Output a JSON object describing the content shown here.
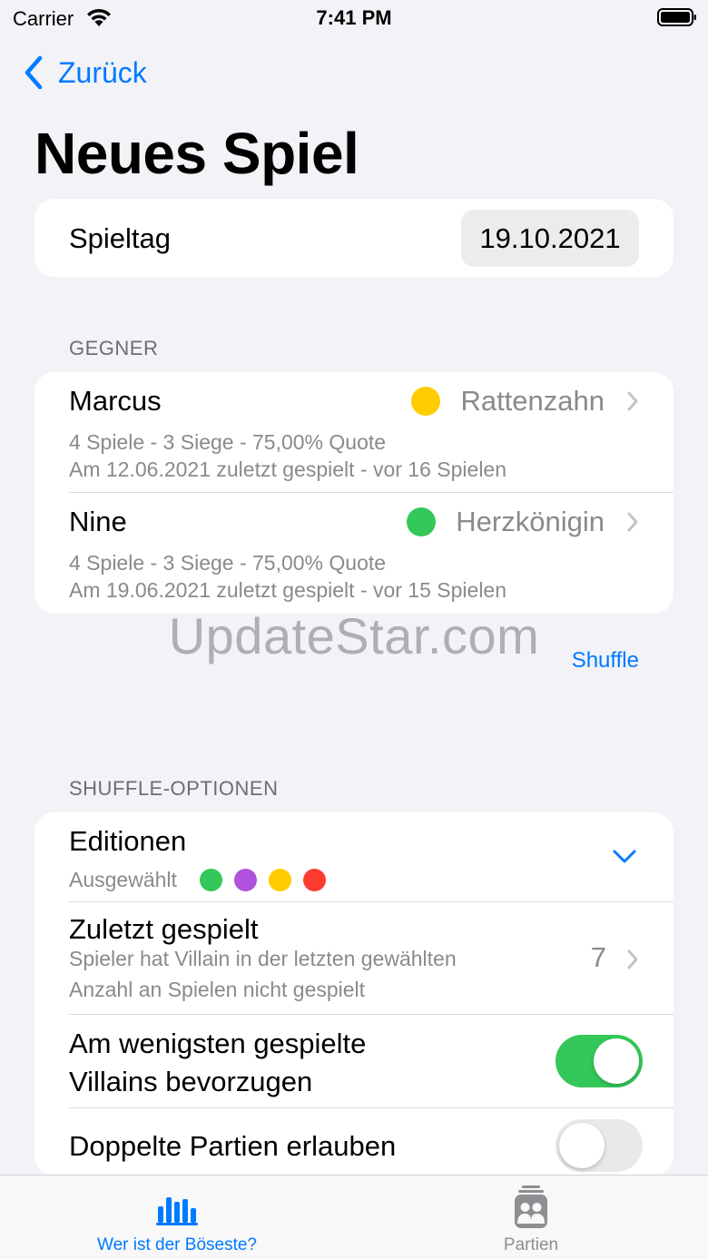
{
  "status_bar": {
    "carrier": "Carrier",
    "time": "7:41 PM"
  },
  "nav": {
    "back_label": "Zurück",
    "title": "Neues Spiel"
  },
  "spieltag": {
    "label": "Spieltag",
    "date": "19.10.2021"
  },
  "gegner": {
    "header": "GEGNER",
    "opponents": [
      {
        "name": "Marcus",
        "villain": "Rattenzahn",
        "dot_color": "#ffcc00",
        "stats": "4 Spiele - 3 Siege - 75,00% Quote",
        "last_played": "Am 12.06.2021 zuletzt gespielt - vor 16 Spielen"
      },
      {
        "name": "Nine",
        "villain": "Herzkönigin",
        "dot_color": "#34c759",
        "stats": "4 Spiele - 3 Siege - 75,00% Quote",
        "last_played": "Am 19.06.2021 zuletzt gespielt - vor 15 Spielen"
      }
    ]
  },
  "watermark": "UpdateStar.com",
  "shuffle_label": "Shuffle",
  "shuffle_options": {
    "header": "SHUFFLE-OPTIONEN",
    "editionen": {
      "title": "Editionen",
      "subtitle": "Ausgewählt",
      "dots": [
        "#34c759",
        "#af52de",
        "#ffcc00",
        "#ff3b30"
      ]
    },
    "zuletzt": {
      "title": "Zuletzt gespielt",
      "line1": "Spieler hat Villain in der letzten gewählten",
      "line2": "Anzahl an Spielen nicht gespielt",
      "value": "7"
    },
    "least_played": {
      "line1": "Am wenigsten gespielte",
      "line2": "Villains bevorzugen",
      "enabled": true
    },
    "duplicates": {
      "title": "Doppelte Partien erlauben",
      "enabled": false
    }
  },
  "tabs": [
    {
      "label": "Wer ist der Böseste?",
      "icon": "bar-chart-icon",
      "active": true,
      "color": "#007aff"
    },
    {
      "label": "Partien",
      "icon": "group-icon",
      "active": false,
      "color": "#8e8e93"
    }
  ]
}
